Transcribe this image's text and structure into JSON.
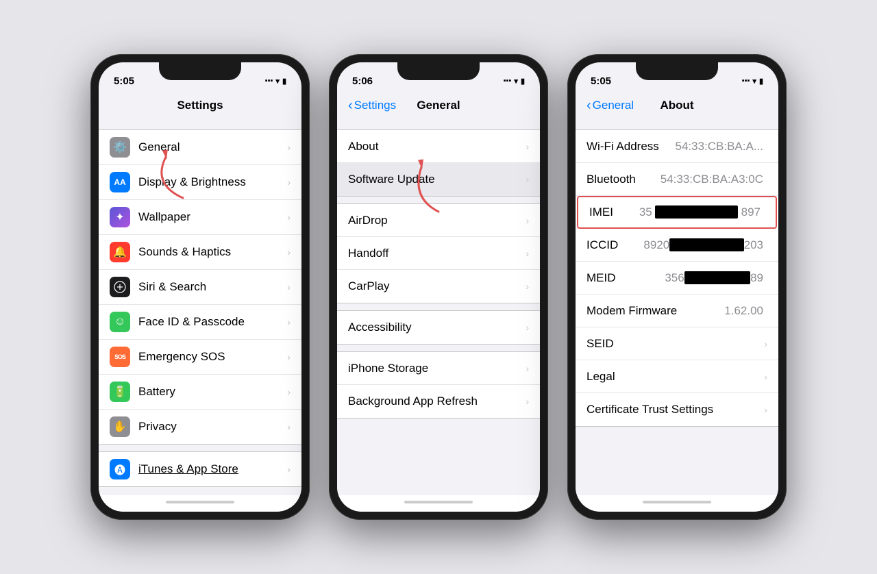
{
  "phone1": {
    "status": {
      "time": "5:05",
      "carrier": "..ll",
      "wifi": "wifi",
      "battery": "battery"
    },
    "nav": {
      "title": "Settings",
      "back": null
    },
    "items": [
      {
        "id": "general",
        "label": "General",
        "iconBg": "#8e8e93",
        "icon": "⚙️"
      },
      {
        "id": "display",
        "label": "Display & Brightness",
        "iconBg": "#007aff",
        "icon": "AA"
      },
      {
        "id": "wallpaper",
        "label": "Wallpaper",
        "iconBg": "#5856d6",
        "icon": "✦"
      },
      {
        "id": "sounds",
        "label": "Sounds & Haptics",
        "iconBg": "#ff3b30",
        "icon": "🔊"
      },
      {
        "id": "siri",
        "label": "Siri & Search",
        "iconBg": "#000",
        "icon": "◈"
      },
      {
        "id": "faceid",
        "label": "Face ID & Passcode",
        "iconBg": "#34c759",
        "icon": "☻"
      },
      {
        "id": "sos",
        "label": "Emergency SOS",
        "iconBg": "#ff3b30",
        "icon": "SOS"
      },
      {
        "id": "battery",
        "label": "Battery",
        "iconBg": "#34c759",
        "icon": "▮"
      },
      {
        "id": "privacy",
        "label": "Privacy",
        "iconBg": "#8e8e93",
        "icon": "✋"
      },
      {
        "id": "itunes",
        "label": "iTunes & App Store",
        "iconBg": "#007aff",
        "icon": "🅐"
      }
    ]
  },
  "phone2": {
    "status": {
      "time": "5:06"
    },
    "nav": {
      "title": "General",
      "back": "Settings"
    },
    "items": [
      {
        "id": "about",
        "label": "About"
      },
      {
        "id": "software",
        "label": "Software Update"
      },
      {
        "id": "airdrop",
        "label": "AirDrop"
      },
      {
        "id": "handoff",
        "label": "Handoff"
      },
      {
        "id": "carplay",
        "label": "CarPlay"
      },
      {
        "id": "accessibility",
        "label": "Accessibility"
      },
      {
        "id": "storage",
        "label": "iPhone Storage"
      },
      {
        "id": "refresh",
        "label": "Background App Refresh"
      }
    ]
  },
  "phone3": {
    "status": {
      "time": "5:05"
    },
    "nav": {
      "title": "About",
      "back": "General"
    },
    "rows": [
      {
        "id": "wifi",
        "label": "Wi-Fi Address",
        "value": "54:33:CB:BA:A...",
        "hasChevron": false
      },
      {
        "id": "bluetooth",
        "label": "Bluetooth",
        "value": "54:33:CB:BA:A3:0C",
        "hasChevron": false
      },
      {
        "id": "imei",
        "label": "IMEI",
        "value": "35 ████████ 897",
        "hasChevron": false,
        "highlight": true
      },
      {
        "id": "iccid",
        "label": "ICCID",
        "value": "8920████████203",
        "hasChevron": false
      },
      {
        "id": "meid",
        "label": "MEID",
        "value": "356████████89",
        "hasChevron": false
      },
      {
        "id": "modem",
        "label": "Modem Firmware",
        "value": "1.62.00",
        "hasChevron": false
      },
      {
        "id": "seid",
        "label": "SEID",
        "value": "",
        "hasChevron": true
      },
      {
        "id": "legal",
        "label": "Legal",
        "value": "",
        "hasChevron": true
      },
      {
        "id": "cert",
        "label": "Certificate Trust Settings",
        "value": "",
        "hasChevron": true
      }
    ]
  },
  "icons": {
    "general_bg": "#8e8e93",
    "display_bg": "#007aff",
    "wallpaper_bg": "#5856d6",
    "sounds_bg": "#ff3b30",
    "siri_bg": "#1c1c1e",
    "faceid_bg": "#34c759",
    "sos_bg": "#ff6b35",
    "battery_bg": "#34c759",
    "privacy_bg": "#8e8e93",
    "itunes_bg": "#007aff"
  }
}
